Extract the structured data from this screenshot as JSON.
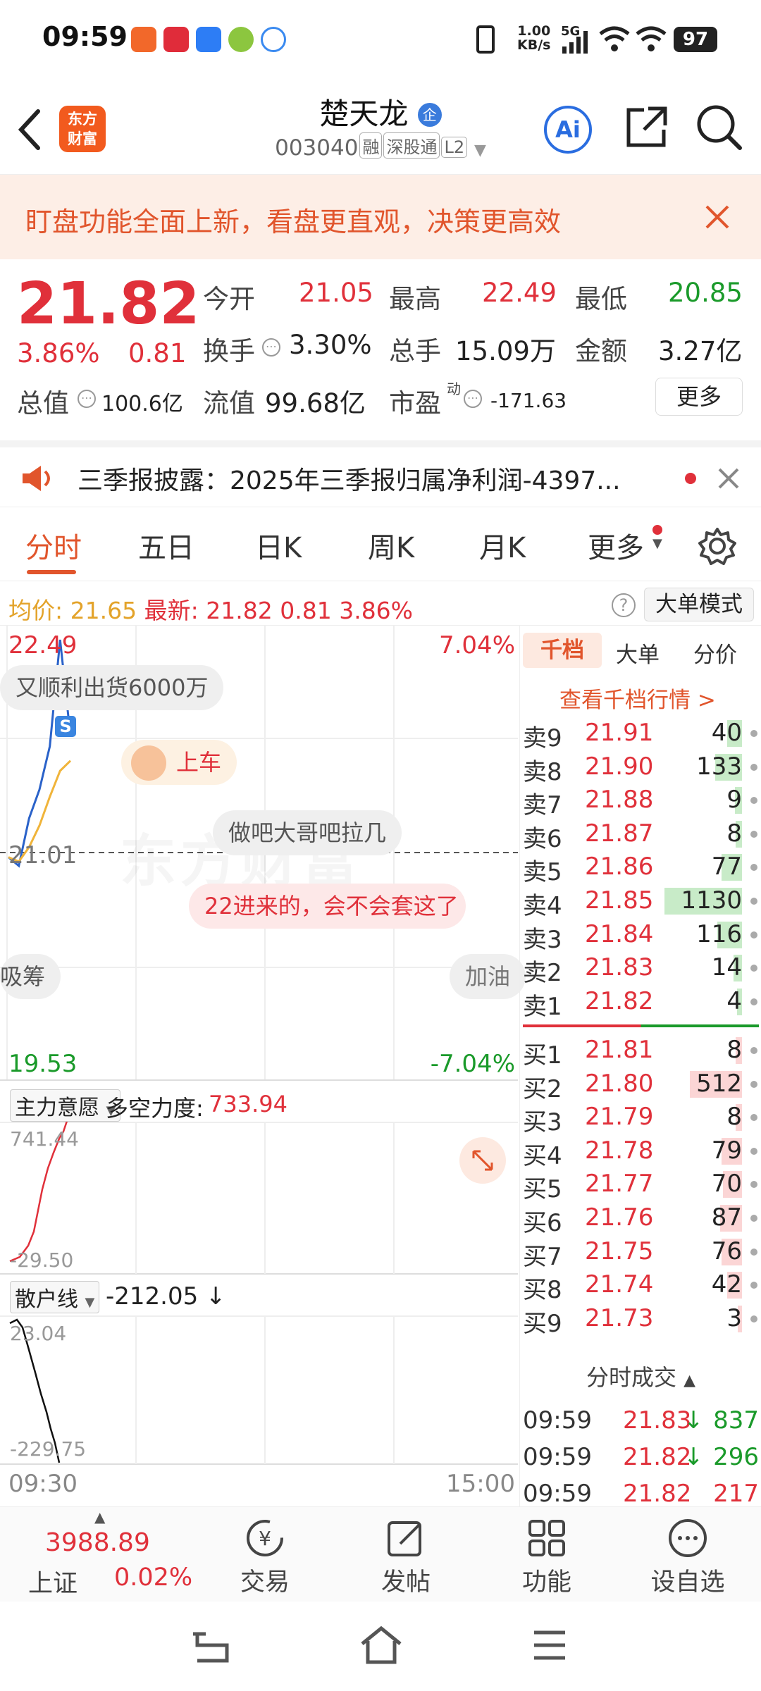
{
  "status_bar": {
    "time": "09:59",
    "net_speed_top": "1.00",
    "net_speed_bottom": "KB/s",
    "network": "5G",
    "battery": "97"
  },
  "header": {
    "logo_text_top": "东方",
    "logo_text_bottom": "财富",
    "stock_name": "楚天龙",
    "name_badge": "企",
    "stock_code": "003040",
    "tags": [
      "融",
      "深股通",
      "L2"
    ],
    "ai_label": "Ai"
  },
  "banner": {
    "text": "盯盘功能全面上新，看盘更直观，决策更高效"
  },
  "quote": {
    "price": "21.82",
    "change_pct": "3.86%",
    "change": "0.81",
    "open_label": "今开",
    "open": "21.05",
    "high_label": "最高",
    "high": "22.49",
    "low_label": "最低",
    "low": "20.85",
    "turnover_label": "换手",
    "turnover": "3.30%",
    "volume_label": "总手",
    "volume": "15.09万",
    "amount_label": "金额",
    "amount": "3.27亿",
    "mktcap_label": "总值",
    "mktcap": "100.6亿",
    "float_label": "流值",
    "float_cap": "99.68亿",
    "pe_label": "市盈",
    "pe_sup": "动",
    "pe": "-171.63",
    "more_label": "更多"
  },
  "news": {
    "text": "三季报披露：2025年三季报归属净利润-4397..."
  },
  "tabs": [
    "分时",
    "五日",
    "日K",
    "周K",
    "月K",
    "更多"
  ],
  "avg_line": {
    "avg_label": "均价:",
    "avg": "21.65",
    "latest_label": "最新:",
    "latest": "21.82",
    "change": "0.81",
    "pct": "3.86%",
    "mode_button": "大单模式"
  },
  "chart": {
    "top_price": "22.49",
    "top_pct": "7.04%",
    "mid_price": "21.01",
    "bottom_price": "19.53",
    "bottom_pct": "-7.04%",
    "watermark": "东方财富",
    "s_marker": "S",
    "time_start": "09:30",
    "time_end": "15:00",
    "bubbles": [
      "又顺利出货6000万",
      "上车",
      "做吧大哥吧拉几",
      "22进来的，会不会套这了",
      "吸筹",
      "加油"
    ],
    "sub1_name": "主力意愿",
    "sub1_indicator": "多空力度:",
    "sub1_value": "733.94",
    "sub1_top": "741.44",
    "sub1_bottom": "-29.50",
    "sub2_name": "散户线",
    "sub2_value": "-212.05 ↓",
    "sub2_top": "23.04",
    "sub2_bottom": "-229.75"
  },
  "chart_data": [
    {
      "type": "line",
      "title": "",
      "x": [
        "09:30",
        "09:35",
        "09:40",
        "09:45",
        "09:50",
        "09:55",
        "09:59"
      ],
      "series": [
        {
          "name": "",
          "values": [
            20.98,
            20.92,
            21.25,
            21.45,
            21.75,
            22.49,
            21.82
          ]
        },
        {
          "name": "均价",
          "values": [
            20.98,
            20.95,
            21.05,
            21.2,
            21.4,
            21.58,
            21.65
          ]
        }
      ],
      "ylim": [
        19.53,
        22.49
      ]
    }
  ],
  "order_book": {
    "tabs": [
      "千档",
      "大单",
      "分价"
    ],
    "link": "查看千档行情 >",
    "asks": [
      {
        "name": "卖9",
        "price": "21.91",
        "vol": "40"
      },
      {
        "name": "卖8",
        "price": "21.90",
        "vol": "133"
      },
      {
        "name": "卖7",
        "price": "21.88",
        "vol": "9"
      },
      {
        "name": "卖6",
        "price": "21.87",
        "vol": "8"
      },
      {
        "name": "卖5",
        "price": "21.86",
        "vol": "77"
      },
      {
        "name": "卖4",
        "price": "21.85",
        "vol": "1130"
      },
      {
        "name": "卖3",
        "price": "21.84",
        "vol": "116"
      },
      {
        "name": "卖2",
        "price": "21.83",
        "vol": "14"
      },
      {
        "name": "卖1",
        "price": "21.82",
        "vol": "4"
      }
    ],
    "bids": [
      {
        "name": "买1",
        "price": "21.81",
        "vol": "8"
      },
      {
        "name": "买2",
        "price": "21.80",
        "vol": "512"
      },
      {
        "name": "买3",
        "price": "21.79",
        "vol": "8"
      },
      {
        "name": "买4",
        "price": "21.78",
        "vol": "79"
      },
      {
        "name": "买5",
        "price": "21.77",
        "vol": "70"
      },
      {
        "name": "买6",
        "price": "21.76",
        "vol": "87"
      },
      {
        "name": "买7",
        "price": "21.75",
        "vol": "76"
      },
      {
        "name": "买8",
        "price": "21.74",
        "vol": "42"
      },
      {
        "name": "买9",
        "price": "21.73",
        "vol": "3"
      }
    ],
    "trades_title": "分时成交",
    "trades": [
      {
        "time": "09:59",
        "price": "21.83",
        "arrow": "↓",
        "vol": "837"
      },
      {
        "time": "09:59",
        "price": "21.82",
        "arrow": "↓",
        "vol": "296"
      },
      {
        "time": "09:59",
        "price": "21.82",
        "arrow": "",
        "vol": "217"
      }
    ]
  },
  "bottom_nav": {
    "index_value": "3988.89",
    "index_name": "上证",
    "index_pct": "0.02%",
    "items": [
      "交易",
      "发帖",
      "功能",
      "设自选"
    ]
  }
}
